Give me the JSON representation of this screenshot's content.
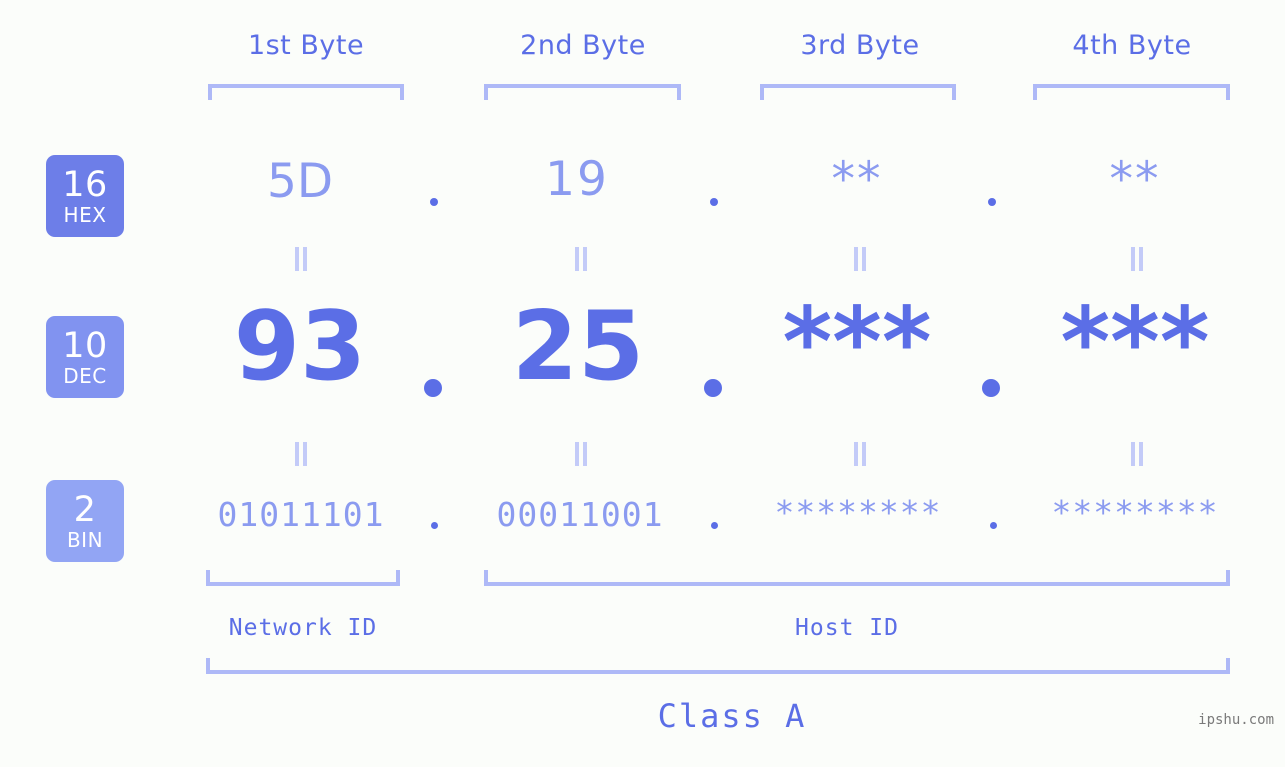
{
  "headers": [
    {
      "label": "1st Byte"
    },
    {
      "label": "2nd Byte"
    },
    {
      "label": "3rd Byte"
    },
    {
      "label": "4th Byte"
    }
  ],
  "bases": [
    {
      "number": "16",
      "name": "HEX",
      "color": "#6d7ee8"
    },
    {
      "number": "10",
      "name": "DEC",
      "color": "#8193f0"
    },
    {
      "number": "2",
      "name": "BIN",
      "color": "#92a5f4"
    }
  ],
  "rows": {
    "hex": {
      "bytes": [
        "5D",
        "19",
        "**",
        "**"
      ]
    },
    "dec": {
      "bytes": [
        "93",
        "25",
        "***",
        "***"
      ]
    },
    "bin": {
      "bytes": [
        "01011101",
        "00011001",
        "********",
        "********"
      ]
    }
  },
  "separator": ".",
  "equivalence": "=",
  "sections": [
    {
      "label": "Network ID"
    },
    {
      "label": "Host ID"
    }
  ],
  "class_label": "Class A",
  "watermark": "ipshu.com",
  "colors": {
    "background": "#fbfdfa",
    "accent_strong": "#5b6ee6",
    "accent_mid": "#8b9bf0",
    "accent_light": "#aeb9f7",
    "eq_marker": "#c3cbf8",
    "watermark": "#7a7a7a"
  }
}
